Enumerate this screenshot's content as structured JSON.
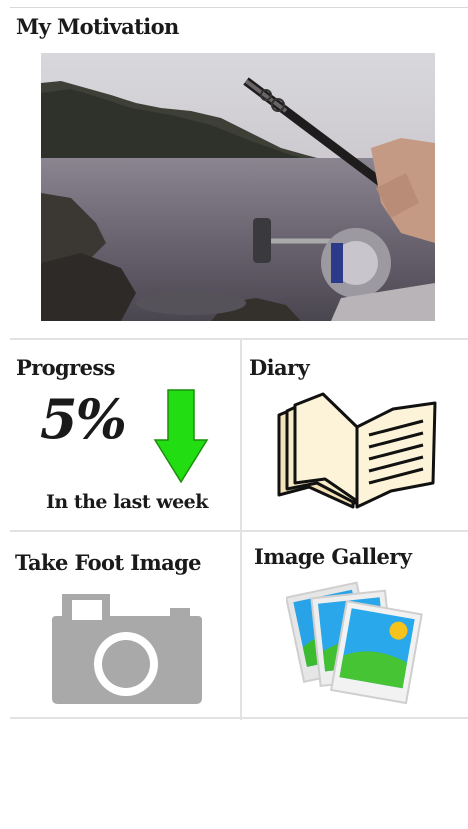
{
  "motivation": {
    "title": "My Motivation",
    "image_icon": "fishing-photo"
  },
  "tiles": {
    "progress": {
      "title": "Progress",
      "percent": "5%",
      "trend": "down",
      "trend_color": "#22dd11",
      "caption": "In the last week"
    },
    "diary": {
      "title": "Diary",
      "icon": "open-book-icon"
    },
    "foot_image": {
      "title": "Take Foot Image",
      "icon": "camera-icon"
    },
    "gallery": {
      "title": "Image Gallery",
      "icon": "photos-icon"
    }
  }
}
